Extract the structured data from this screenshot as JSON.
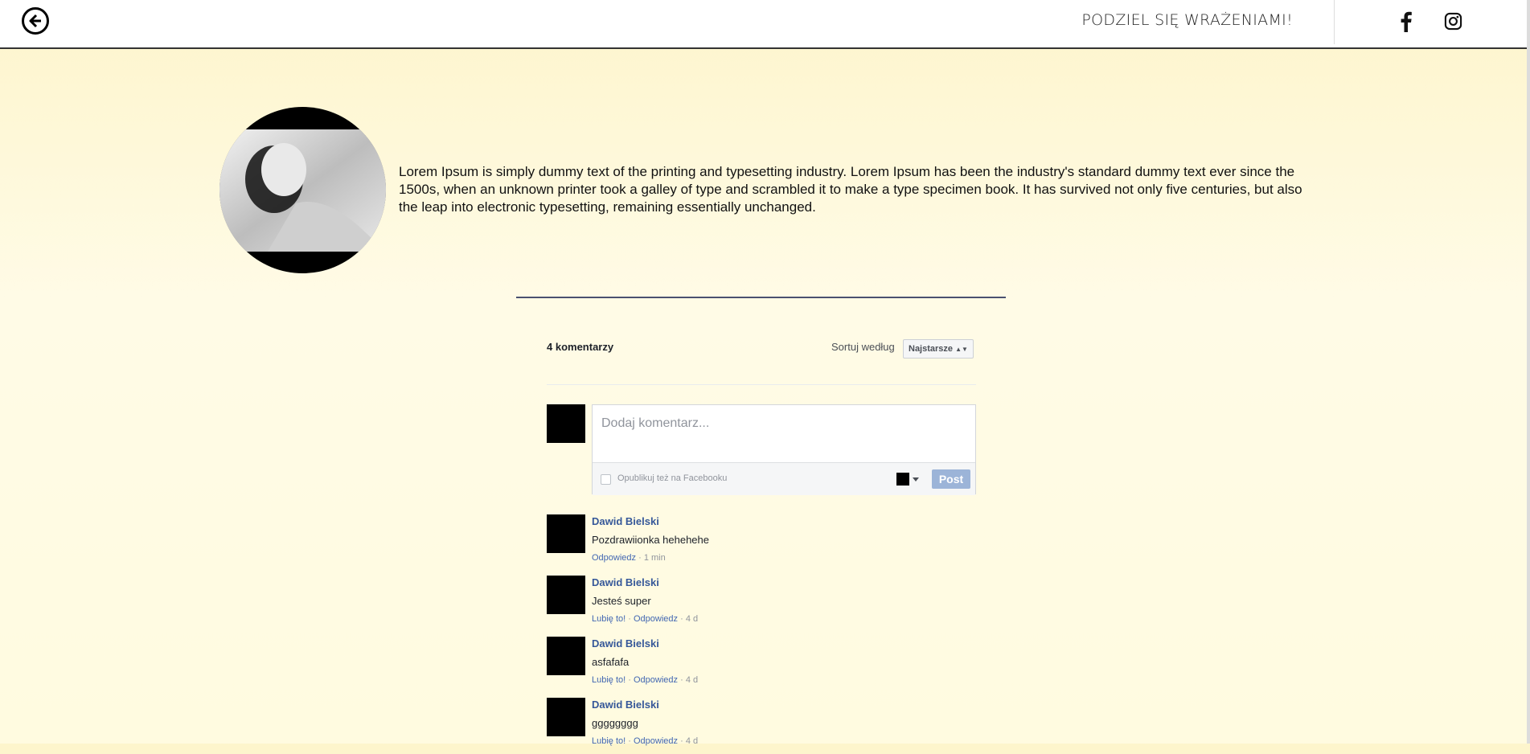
{
  "header": {
    "title": "PODZIEL SIĘ WRAŻENIAMI!",
    "back_icon": "arrow-left-circle-icon",
    "social": [
      "facebook-icon",
      "instagram-icon"
    ]
  },
  "profile": {
    "bio": "Lorem Ipsum is simply dummy text of the printing and typesetting industry. Lorem Ipsum has been the industry's standard dummy text ever since the 1500s, when an unknown printer took a galley of type and scrambled it to make a type specimen book. It has survived not only five centuries, but also the leap into electronic typesetting, remaining essentially unchanged."
  },
  "fb_comments": {
    "count_label": "4 komentarzy",
    "sort_label": "Sortuj według",
    "sort_value": "Najstarsze",
    "composer_placeholder": "Dodaj komentarz...",
    "publish_label": "Opublikuj też na Facebooku",
    "post_label": "Post",
    "comments": [
      {
        "author": "Dawid Bielski",
        "text": "Pozdrawiionka hehehehe",
        "like": "",
        "reply": "Odpowiedz",
        "time": "1 min"
      },
      {
        "author": "Dawid Bielski",
        "text": "Jesteś super",
        "like": "Lubię to!",
        "reply": "Odpowiedz",
        "time": "4 d"
      },
      {
        "author": "Dawid Bielski",
        "text": "asfafafa",
        "like": "Lubię to!",
        "reply": "Odpowiedz",
        "time": "4 d"
      },
      {
        "author": "Dawid Bielski",
        "text": "gggggggg",
        "like": "Lubię to!",
        "reply": "Odpowiedz",
        "time": "4 d"
      }
    ]
  },
  "colors": {
    "link": "#365899",
    "post_button": "#9cb4d8",
    "divider": "#4a5170"
  }
}
